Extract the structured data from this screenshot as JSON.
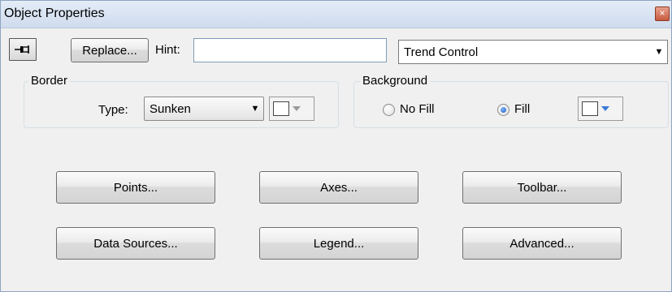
{
  "window": {
    "title": "Object Properties",
    "close_icon": "×"
  },
  "toolbar": {
    "pin_icon": "pin-icon",
    "replace_label": "Replace...",
    "hint_label": "Hint:",
    "hint_value": "",
    "type_combo_value": "Trend Control",
    "dropdown_arrow": "▼"
  },
  "border": {
    "group_label": "Border",
    "type_label": "Type:",
    "type_value": "Sunken",
    "color_value": "#ffffff"
  },
  "background": {
    "group_label": "Background",
    "no_fill_label": "No Fill",
    "fill_label": "Fill",
    "selected": "Fill",
    "color_value": "#ffffff"
  },
  "buttons": {
    "points": "Points...",
    "axes": "Axes...",
    "toolbar": "Toolbar...",
    "data_sources": "Data Sources...",
    "legend": "Legend...",
    "advanced": "Advanced..."
  },
  "colors": {
    "titlebar": "#cfdcee",
    "window_bg": "#f0f0f0",
    "accent_blue": "#3a7bd5"
  }
}
